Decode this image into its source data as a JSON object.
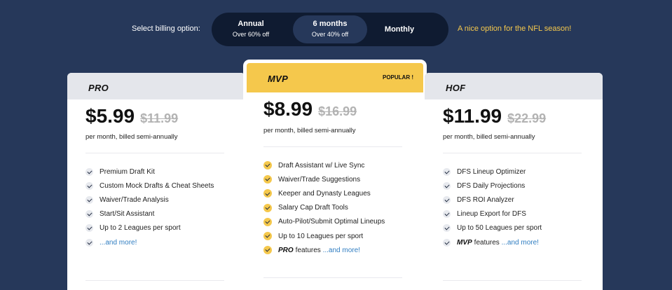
{
  "billing": {
    "label": "Select billing option:",
    "options": [
      {
        "title": "Annual",
        "sub": "Over 60% off"
      },
      {
        "title": "6 months",
        "sub": "Over 40% off",
        "selected": true
      },
      {
        "title": "Monthly",
        "sub": ""
      }
    ],
    "note": "A nice option for the NFL season!"
  },
  "colors": {
    "background": "#26385a",
    "toggle_bg": "#0f1b31",
    "accent_yellow": "#f5c84c",
    "link_blue": "#2f7dc1",
    "header_gray": "#e4e6eb"
  },
  "plans": [
    {
      "name": "PRO",
      "price": "$5.99",
      "old_price": "$11.99",
      "billing_text": "per month, billed semi-annually",
      "features": [
        "Premium Draft Kit",
        "Custom Mock Drafts & Cheat Sheets",
        "Waiver/Trade Analysis",
        "Start/Sit Assistant",
        "Up to 2 Leagues per sport"
      ],
      "more_prefix": "",
      "more_link": "...and more!"
    },
    {
      "name": "MVP",
      "badge": "POPULAR !",
      "price": "$8.99",
      "old_price": "$16.99",
      "billing_text": "per month, billed semi-annually",
      "features": [
        "Draft Assistant w/ Live Sync",
        "Waiver/Trade Suggestions",
        "Keeper and Dynasty Leagues",
        "Salary Cap Draft Tools",
        "Auto-Pilot/Submit Optimal Lineups",
        "Up to 10 Leagues per sport"
      ],
      "more_prefix": "PRO",
      "more_mid": "features",
      "more_link": "...and more!"
    },
    {
      "name": "HOF",
      "price": "$11.99",
      "old_price": "$22.99",
      "billing_text": "per month, billed semi-annually",
      "features": [
        "DFS Lineup Optimizer",
        "DFS Daily Projections",
        "DFS ROI Analyzer",
        "Lineup Export for DFS",
        "Up to 50 Leagues per sport"
      ],
      "more_prefix": "MVP",
      "more_mid": "features",
      "more_link": "...and more!"
    }
  ]
}
